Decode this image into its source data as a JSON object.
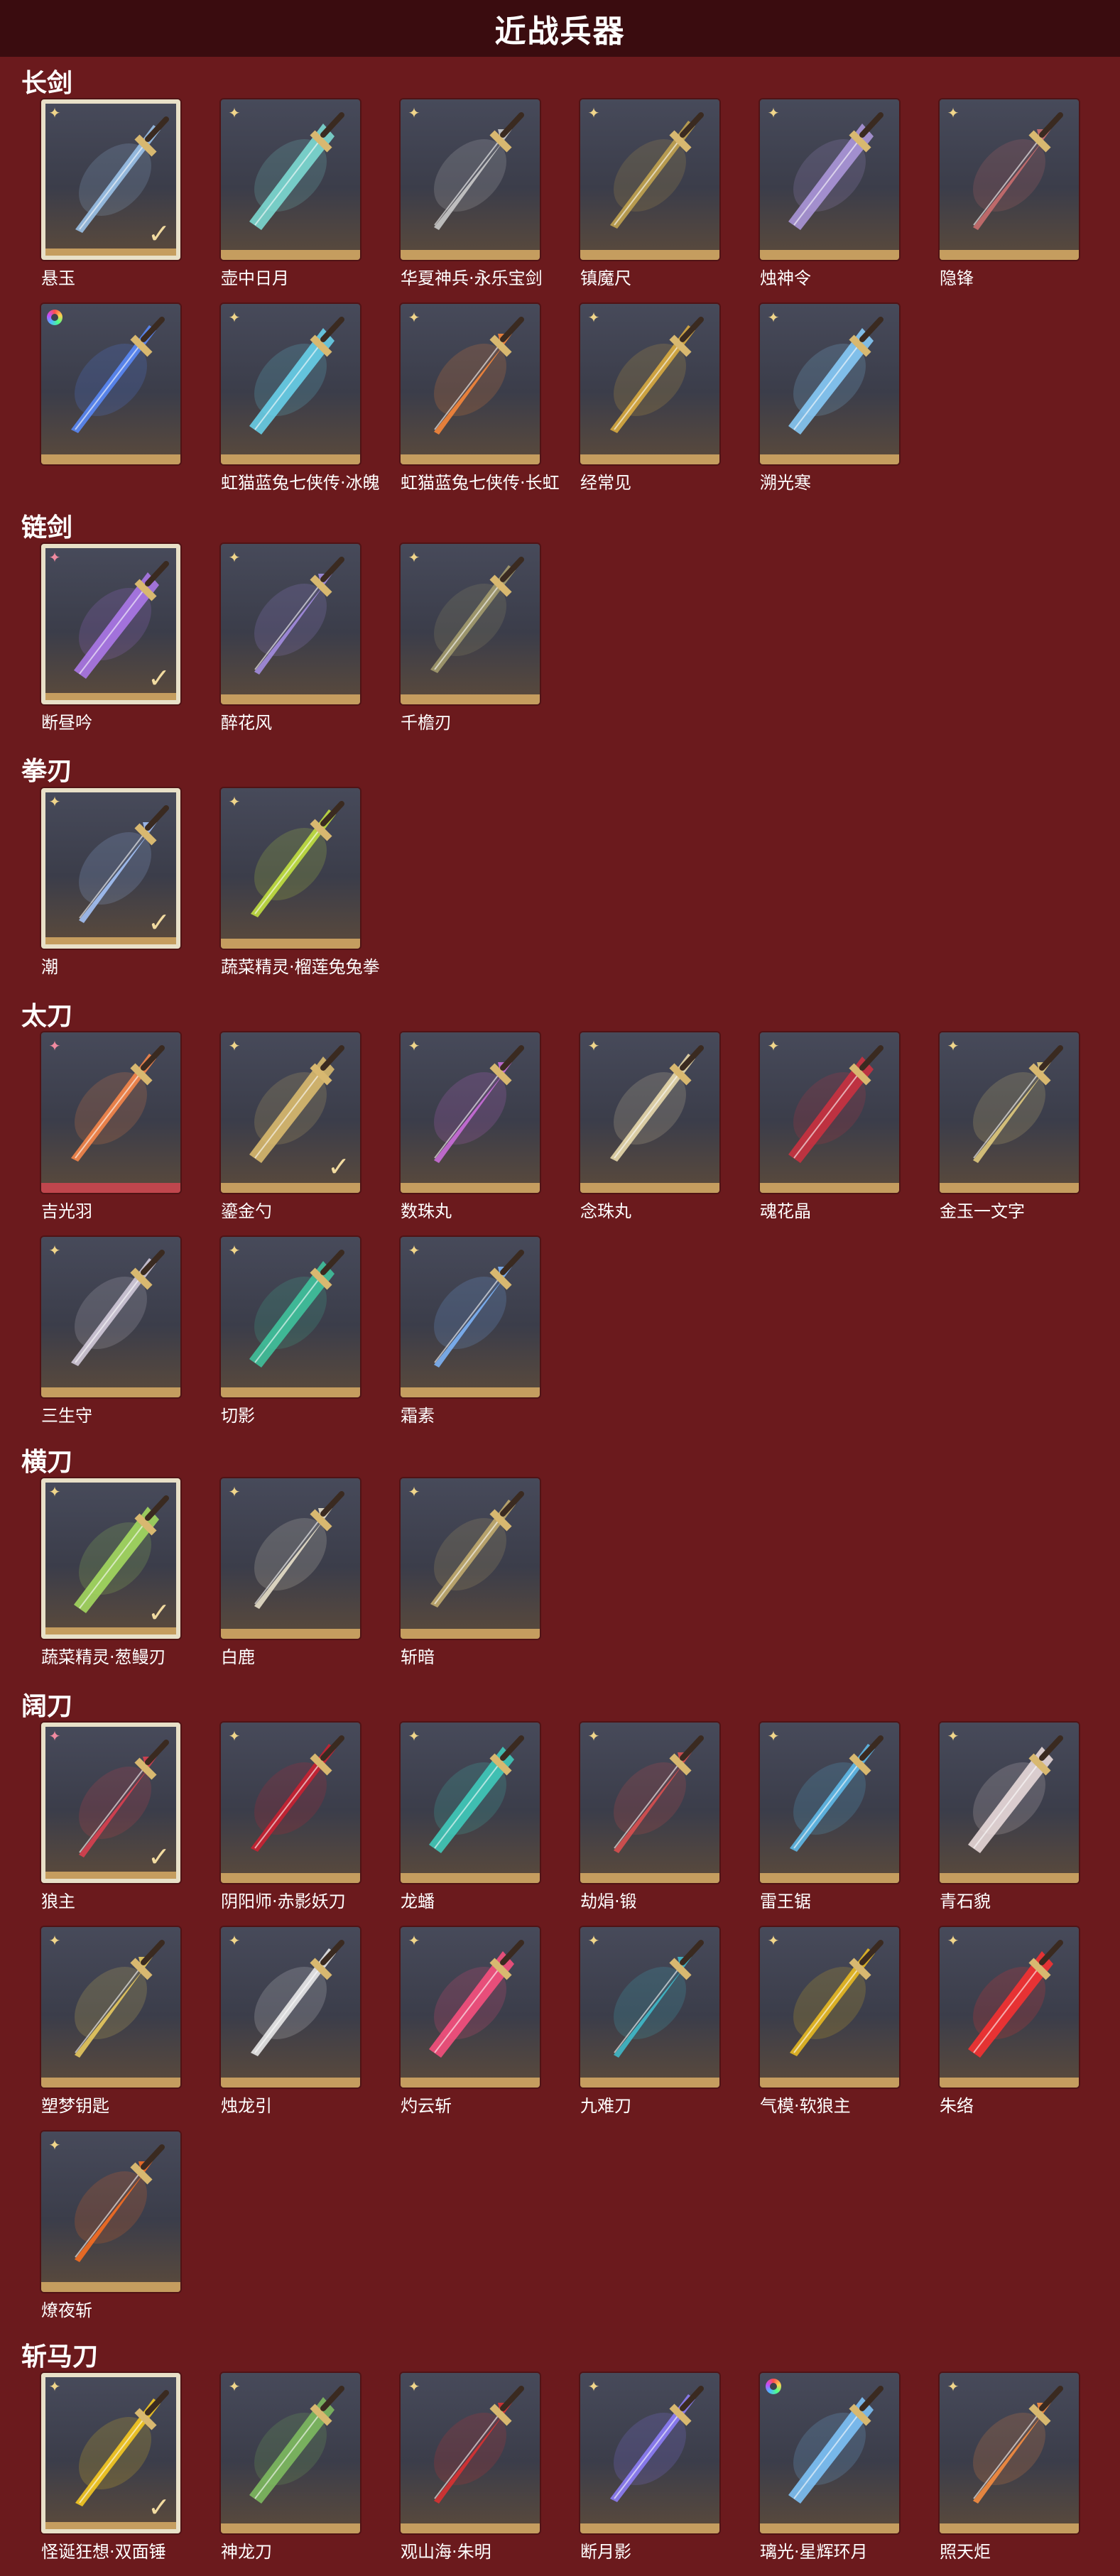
{
  "title": "近战兵器",
  "icons": {
    "star": "star-badge-icon",
    "pink_star": "pink-star-badge-icon",
    "ring": "rainbow-ring-badge-icon",
    "check": "check-icon"
  },
  "colors": {
    "background": "#6b1a1d",
    "titlebar": "#3a0c0f",
    "card_bar": "#c59d5f",
    "selected_border": "#e8e0c8"
  },
  "sections": [
    {
      "name": "长剑",
      "items": [
        {
          "label": "悬玉",
          "badge": "star",
          "selected": true,
          "accent": "#9fc8f0"
        },
        {
          "label": "壶中日月",
          "badge": "star",
          "accent": "#7fe0d8"
        },
        {
          "label": "华夏神兵·永乐宝剑",
          "badge": "star",
          "accent": "#d0d0d0"
        },
        {
          "label": "镇魔尺",
          "badge": "star",
          "accent": "#c8a850"
        },
        {
          "label": "烛神令",
          "badge": "star",
          "accent": "#b09ae0"
        },
        {
          "label": "隐锋",
          "badge": "star",
          "accent": "#d07070"
        },
        {
          "label": "",
          "badge": "ring",
          "accent": "#5a8cff"
        },
        {
          "label": "虹猫蓝兔七侠传·冰魄",
          "badge": "star",
          "accent": "#6ad6f0"
        },
        {
          "label": "虹猫蓝兔七侠传·长虹",
          "badge": "star",
          "accent": "#ff8a3a"
        },
        {
          "label": "经常见",
          "badge": "star",
          "accent": "#e0b040"
        },
        {
          "label": "溯光寒",
          "badge": "star",
          "accent": "#8ad0ff"
        }
      ]
    },
    {
      "name": "链剑",
      "items": [
        {
          "label": "断昼吟",
          "badge": "pink_star",
          "selected": true,
          "accent": "#b07af0"
        },
        {
          "label": "醉花风",
          "badge": "star",
          "accent": "#a890e8"
        },
        {
          "label": "千檐刃",
          "badge": "star",
          "accent": "#a8a070"
        }
      ]
    },
    {
      "name": "拳刃",
      "items": [
        {
          "label": "潮",
          "badge": "star",
          "selected": true,
          "accent": "#a8c8ff"
        },
        {
          "label": "蔬菜精灵·榴莲兔兔拳",
          "badge": "star",
          "accent": "#c8e840"
        }
      ]
    },
    {
      "name": "太刀",
      "items": [
        {
          "label": "吉光羽",
          "badge": "pink_star",
          "pinkbar": true,
          "accent": "#ff8a4a"
        },
        {
          "label": "鎏金勺",
          "badge": "star",
          "selected_tick": true,
          "accent": "#e0c070"
        },
        {
          "label": "数珠丸",
          "badge": "star",
          "accent": "#d070e0"
        },
        {
          "label": "念珠丸",
          "badge": "star",
          "accent": "#f0e0b0"
        },
        {
          "label": "魂花晶",
          "badge": "star",
          "accent": "#d03040"
        },
        {
          "label": "金玉一文字",
          "badge": "star",
          "accent": "#e8d080"
        },
        {
          "label": "三生守",
          "badge": "star",
          "accent": "#d8d0e0"
        },
        {
          "label": "切影",
          "badge": "star",
          "accent": "#40c8a0"
        },
        {
          "label": "霜素",
          "badge": "star",
          "accent": "#80b8ff"
        }
      ]
    },
    {
      "name": "横刀",
      "items": [
        {
          "label": "蔬菜精灵·葱鳗刃",
          "badge": "star",
          "selected": true,
          "accent": "#a8e060"
        },
        {
          "label": "白鹿",
          "badge": "star",
          "accent": "#f0e8d0"
        },
        {
          "label": "斩暗",
          "badge": "star",
          "accent": "#c8b070"
        }
      ]
    },
    {
      "name": "阔刀",
      "items": [
        {
          "label": "狼主",
          "badge": "pink_star",
          "selected": true,
          "accent": "#e04050"
        },
        {
          "label": "阴阳师·赤影妖刀",
          "badge": "star",
          "accent": "#d02030"
        },
        {
          "label": "龙蟠",
          "badge": "star",
          "accent": "#40d0c0"
        },
        {
          "label": "劫焆·锻",
          "badge": "star",
          "accent": "#e05050"
        },
        {
          "label": "雷王锯",
          "badge": "star",
          "accent": "#60c0f0"
        },
        {
          "label": "青石貌",
          "badge": "star",
          "accent": "#f0e0e0"
        },
        {
          "label": "塑梦钥匙",
          "badge": "star",
          "accent": "#f0d060"
        },
        {
          "label": "烛龙引",
          "badge": "star",
          "accent": "#f0f0f0"
        },
        {
          "label": "灼云斩",
          "badge": "star",
          "accent": "#ff5080"
        },
        {
          "label": "九难刀",
          "badge": "star",
          "accent": "#40c0d0"
        },
        {
          "label": "气模·软狼主",
          "badge": "star",
          "accent": "#f0c020"
        },
        {
          "label": "朱络",
          "badge": "star",
          "accent": "#ff3030"
        },
        {
          "label": "燎夜斩",
          "badge": "star",
          "accent": "#ff7020"
        }
      ]
    },
    {
      "name": "斩马刀",
      "items": [
        {
          "label": "怪诞狂想·双面锤",
          "badge": "star",
          "selected": true,
          "accent": "#ffd020"
        },
        {
          "label": "神龙刀",
          "badge": "star",
          "accent": "#80c060"
        },
        {
          "label": "观山海·朱明",
          "badge": "star",
          "accent": "#e03030"
        },
        {
          "label": "断月影",
          "badge": "star",
          "accent": "#9080ff"
        },
        {
          "label": "璃光·星辉环月",
          "badge": "ring",
          "accent": "#80c8ff"
        },
        {
          "label": "照天炬",
          "badge": "star",
          "accent": "#ff9040"
        }
      ]
    }
  ]
}
